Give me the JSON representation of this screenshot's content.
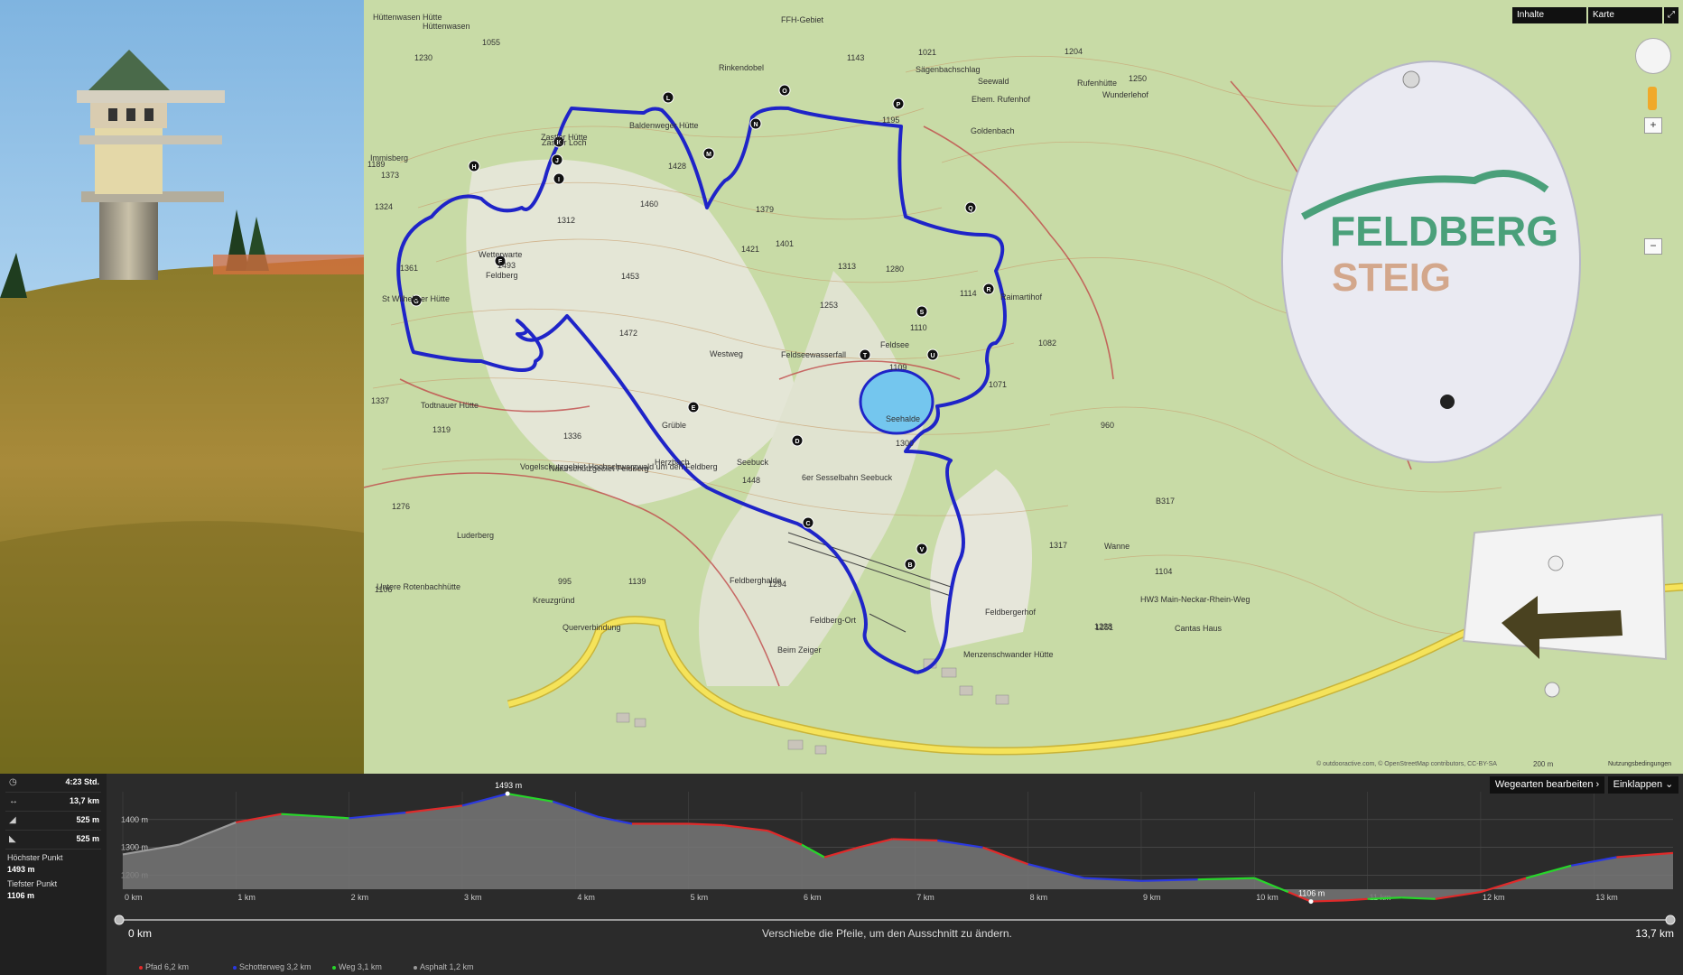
{
  "map": {
    "controls": {
      "contents_label": "Inhalte",
      "map_label": "Karte",
      "zoom_in": "+",
      "zoom_out": "−"
    },
    "scale_text": "200 m",
    "attribution": "© outdooractive.com, © OpenStreetMap contributors, CC-BY-SA",
    "terms": "Nutzungsbedingungen",
    "places": [
      {
        "text": "Hüttenwasen Hütte"
      },
      {
        "text": "Hüttenwasen"
      },
      {
        "text": "Rinkendobel"
      },
      {
        "text": "FFH-Gebiet"
      },
      {
        "text": "Sägenbachschlag"
      },
      {
        "text": "Seewald"
      },
      {
        "text": "Rufenhütte"
      },
      {
        "text": "Ehem. Rufenhof"
      },
      {
        "text": "Zastler Hütte"
      },
      {
        "text": "Zastler Loch"
      },
      {
        "text": "Baldenweger Hütte"
      },
      {
        "text": "Immisberg"
      },
      {
        "text": "Wetterwarte"
      },
      {
        "text": "Feldberg"
      },
      {
        "text": "St Wilhelmer Hütte"
      },
      {
        "text": "Todtnauer Hütte"
      },
      {
        "text": "Feldsee"
      },
      {
        "text": "Feldseewasserfall"
      },
      {
        "text": "Raimartihof"
      },
      {
        "text": "Seehalde"
      },
      {
        "text": "Grüble"
      },
      {
        "text": "Seebuck"
      },
      {
        "text": "6er Sesselbahn Seebuck"
      },
      {
        "text": "Vogelschutzgebiet Hochschwarzwald um den Feldberg"
      },
      {
        "text": "Naturschutzgebiet Feldberg"
      },
      {
        "text": "Herzbach"
      },
      {
        "text": "Luderberg"
      },
      {
        "text": "Untere Rotenbachhütte"
      },
      {
        "text": "Feldberghalde"
      },
      {
        "text": "Feldberg-Ort"
      },
      {
        "text": "Feldbergerhof"
      },
      {
        "text": "Cantas Haus"
      },
      {
        "text": "Menzenschwander Hütte"
      },
      {
        "text": "Beim Zeiger"
      },
      {
        "text": "Querverbindung"
      },
      {
        "text": "Kreuzgründ"
      },
      {
        "text": "Westweg"
      },
      {
        "text": "Goldenbach"
      },
      {
        "text": "Wunderlehof"
      },
      {
        "text": "Wanne"
      },
      {
        "text": "B317"
      },
      {
        "text": "HW3 Main-Neckar-Rhein-Weg"
      },
      {
        "text": "1493"
      },
      {
        "text": "1312"
      },
      {
        "text": "1460"
      },
      {
        "text": "1379"
      },
      {
        "text": "1421"
      },
      {
        "text": "1401"
      },
      {
        "text": "1313"
      },
      {
        "text": "1280"
      },
      {
        "text": "1253"
      },
      {
        "text": "1114"
      },
      {
        "text": "1110"
      },
      {
        "text": "1109"
      },
      {
        "text": "1082"
      },
      {
        "text": "1071"
      },
      {
        "text": "1300"
      },
      {
        "text": "1448"
      },
      {
        "text": "1472"
      },
      {
        "text": "1453"
      },
      {
        "text": "1361"
      },
      {
        "text": "1373"
      },
      {
        "text": "1324"
      },
      {
        "text": "1319"
      },
      {
        "text": "1336"
      },
      {
        "text": "1337"
      },
      {
        "text": "1276"
      },
      {
        "text": "1106"
      },
      {
        "text": "1139"
      },
      {
        "text": "995"
      },
      {
        "text": "1294"
      },
      {
        "text": "1317"
      },
      {
        "text": "1228"
      },
      {
        "text": "1251"
      },
      {
        "text": "960"
      },
      {
        "text": "1104"
      },
      {
        "text": "1021"
      },
      {
        "text": "1143"
      },
      {
        "text": "1204"
      },
      {
        "text": "1195"
      },
      {
        "text": "1250"
      },
      {
        "text": "1428"
      },
      {
        "text": "1055"
      },
      {
        "text": "1230"
      },
      {
        "text": "1189"
      }
    ],
    "waypoints": [
      "B",
      "C",
      "D",
      "E",
      "F",
      "G",
      "H",
      "I",
      "J",
      "K",
      "L",
      "M",
      "N",
      "O",
      "P",
      "Q",
      "R",
      "S",
      "T",
      "U",
      "V"
    ],
    "colors": {
      "route": "#1f24c8",
      "road": "#f3e25a",
      "water": "#74c6ee"
    }
  },
  "sign": {
    "line1": "FELDBERG",
    "line2": "STEIG"
  },
  "stats": {
    "duration": "4:23 Std.",
    "distance": "13,7 km",
    "ascent": "525 m",
    "descent": "525 m",
    "highest_label": "Höchster Punkt",
    "highest_value": "1493 m",
    "lowest_label": "Tiefster Punkt",
    "lowest_value": "1106 m"
  },
  "profile": {
    "toolbar": {
      "edit_label": "Wegearten bearbeiten ›",
      "collapse_label": "Einklappen ⌄"
    },
    "y_ticks": [
      "1400 m",
      "1300 m",
      "1200 m"
    ],
    "x_ticks": [
      "0 km",
      "1 km",
      "2 km",
      "3 km",
      "4 km",
      "5 km",
      "6 km",
      "7 km",
      "8 km",
      "9 km",
      "10 km",
      "11 km",
      "12 km",
      "13 km"
    ],
    "max_label": "1493 m",
    "min_label": "1106 m",
    "range_start": "0 km",
    "range_end": "13,7 km",
    "hint": "Verschiebe die Pfeile, um den Ausschnitt zu ändern.",
    "legend": [
      {
        "label": "Pfad 6,2 km",
        "color": "#e02a2a"
      },
      {
        "label": "Schotterweg 3,2 km",
        "color": "#2a38e0"
      },
      {
        "label": "Weg 3,1 km",
        "color": "#27d62a"
      },
      {
        "label": "Asphalt 1,2 km",
        "color": "#9a9a9a"
      }
    ],
    "chart_data": {
      "type": "area",
      "x": [
        0,
        0.5,
        1,
        1.4,
        2,
        2.5,
        3,
        3.4,
        3.8,
        4.2,
        4.5,
        5,
        5.3,
        5.7,
        6,
        6.2,
        6.5,
        6.8,
        7.2,
        7.6,
        8,
        8.5,
        9,
        9.5,
        10,
        10.3,
        10.5,
        10.8,
        11,
        11.3,
        11.6,
        12,
        12.4,
        12.8,
        13.2,
        13.7
      ],
      "y": [
        1275,
        1310,
        1390,
        1420,
        1405,
        1425,
        1450,
        1493,
        1465,
        1410,
        1385,
        1385,
        1380,
        1360,
        1310,
        1265,
        1300,
        1330,
        1325,
        1300,
        1240,
        1190,
        1180,
        1185,
        1190,
        1140,
        1106,
        1110,
        1115,
        1120,
        1115,
        1140,
        1190,
        1235,
        1265,
        1280
      ],
      "surface": [
        "gray",
        "gray",
        "red",
        "green",
        "blue",
        "red",
        "blue",
        "green",
        "blue",
        "blue",
        "red",
        "red",
        "red",
        "red",
        "green",
        "red",
        "red",
        "red",
        "blue",
        "red",
        "blue",
        "blue",
        "blue",
        "green",
        "green",
        "red",
        "red",
        "red",
        "green",
        "green",
        "red",
        "red",
        "green",
        "blue",
        "red",
        "gray"
      ],
      "ylim": [
        1150,
        1500
      ],
      "xlim": [
        0,
        13.7
      ]
    }
  }
}
